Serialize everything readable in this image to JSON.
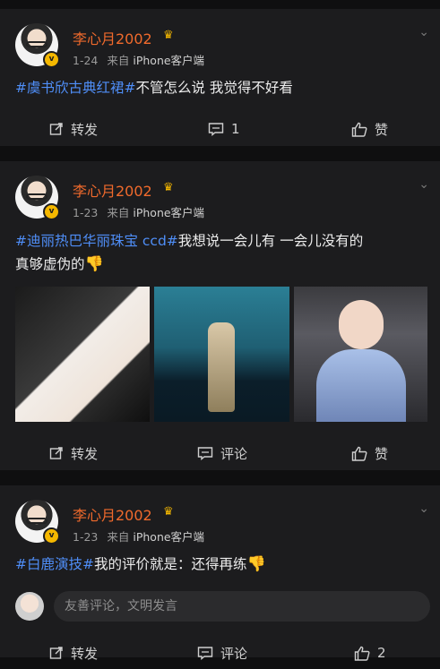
{
  "posts": [
    {
      "user": "李心月2002",
      "date": "1-24",
      "from_prefix": "来自",
      "source": "iPhone客户端",
      "text_tag": "#虞书欣古典红裙#",
      "text_body": "不管怎么说 我觉得不好看",
      "actions": {
        "repost": "转发",
        "comment": "1",
        "like": "赞"
      }
    },
    {
      "user": "李心月2002",
      "date": "1-23",
      "from_prefix": "来自",
      "source": "iPhone客户端",
      "text_tag": "#迪丽热巴华丽珠宝 ccd#",
      "text_body_line1": "我想说一会儿有 一会儿没有的",
      "text_body_line2": "真够虚伪的",
      "emoji": "👎",
      "actions": {
        "repost": "转发",
        "comment": "评论",
        "like": "赞"
      }
    },
    {
      "user": "李心月2002",
      "date": "1-23",
      "from_prefix": "来自",
      "source": "iPhone客户端",
      "text_tag": "#白鹿演技#",
      "text_body": "我的评价就是：还得再练",
      "emoji": "👎",
      "comment_placeholder": "友善评论，文明发言",
      "actions": {
        "repost": "转发",
        "comment": "评论",
        "like": "2"
      }
    }
  ]
}
